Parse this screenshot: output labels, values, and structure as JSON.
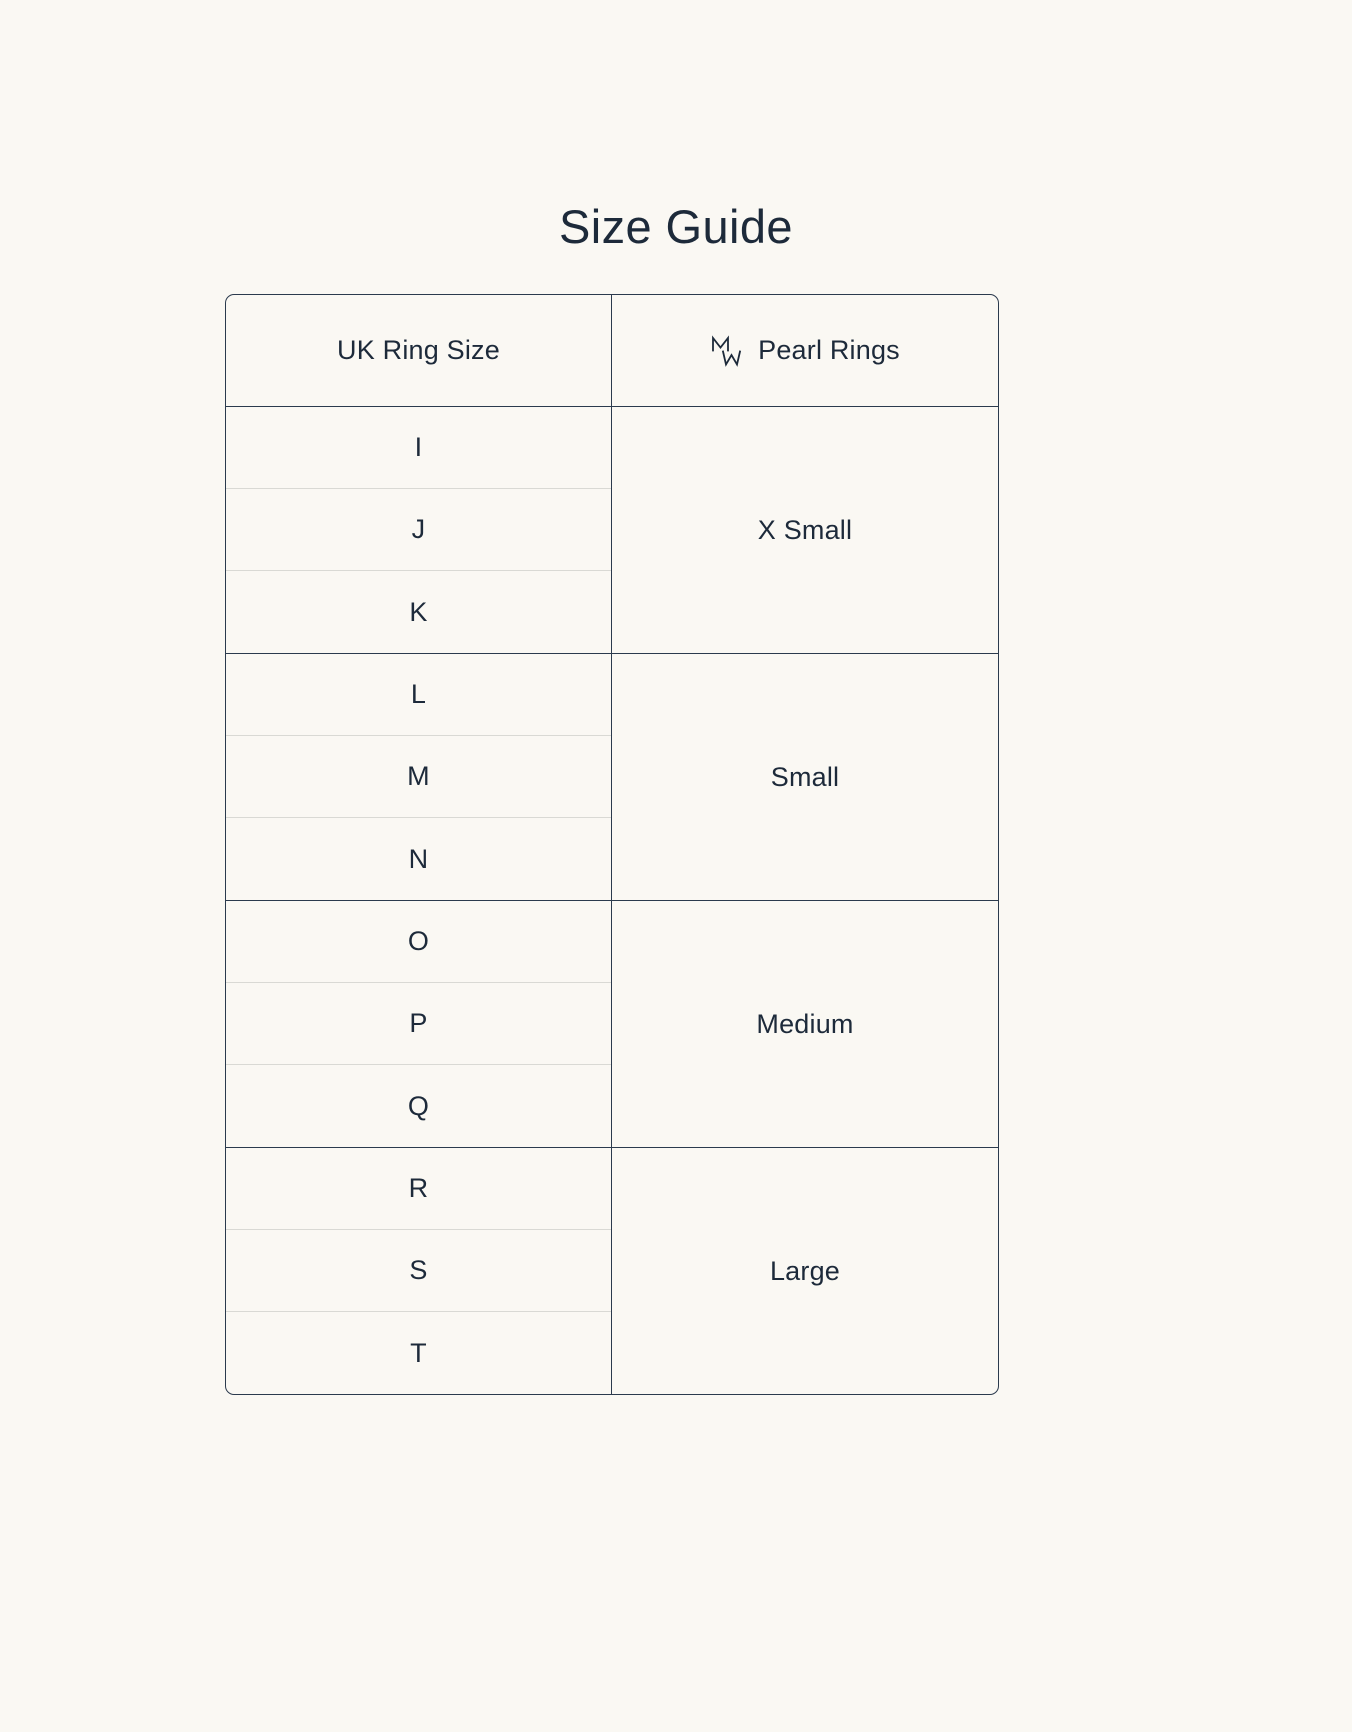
{
  "page": {
    "title": "Size Guide",
    "background_color": "#faf8f3",
    "text_color": "#1d2a3a",
    "border_color": "#2b3a4d",
    "row_divider_color": "#d9d9d4"
  },
  "table": {
    "columns": [
      {
        "label": "UK Ring Size"
      },
      {
        "label": "Pearl Rings",
        "icon": "mw-monogram-logo"
      }
    ],
    "groups": [
      {
        "size_label": "X Small",
        "ring_sizes": [
          "I",
          "J",
          "K"
        ]
      },
      {
        "size_label": "Small",
        "ring_sizes": [
          "L",
          "M",
          "N"
        ]
      },
      {
        "size_label": "Medium",
        "ring_sizes": [
          "O",
          "P",
          "Q"
        ]
      },
      {
        "size_label": "Large",
        "ring_sizes": [
          "R",
          "S",
          "T"
        ]
      }
    ]
  }
}
